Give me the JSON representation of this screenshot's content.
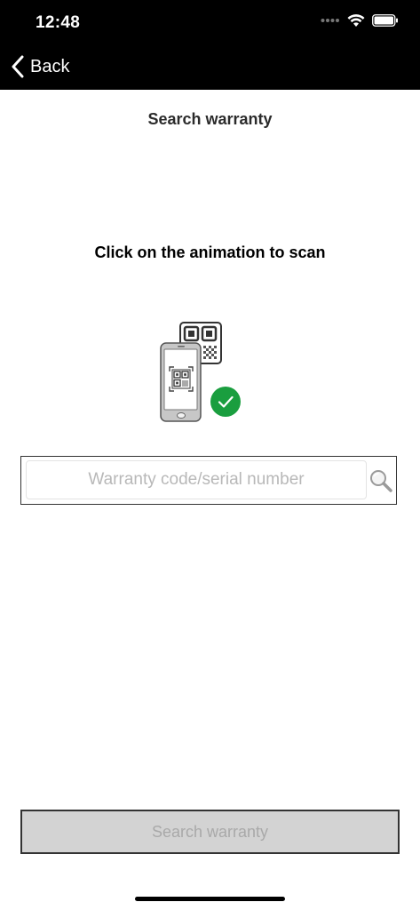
{
  "status_bar": {
    "time": "12:48",
    "icons": [
      "signal-dots-icon",
      "wifi-icon",
      "battery-icon"
    ]
  },
  "nav": {
    "back_label": "Back"
  },
  "page": {
    "title": "Search warranty",
    "instruction": "Click on the animation to scan"
  },
  "search": {
    "placeholder": "Warranty code/serial number",
    "value": ""
  },
  "submit": {
    "label": "Search warranty",
    "enabled": false
  },
  "colors": {
    "bars": "#000000",
    "check_badge": "#1a9e3f",
    "button_disabled_bg": "#d3d3d3",
    "button_disabled_text": "#a9a9a9"
  }
}
